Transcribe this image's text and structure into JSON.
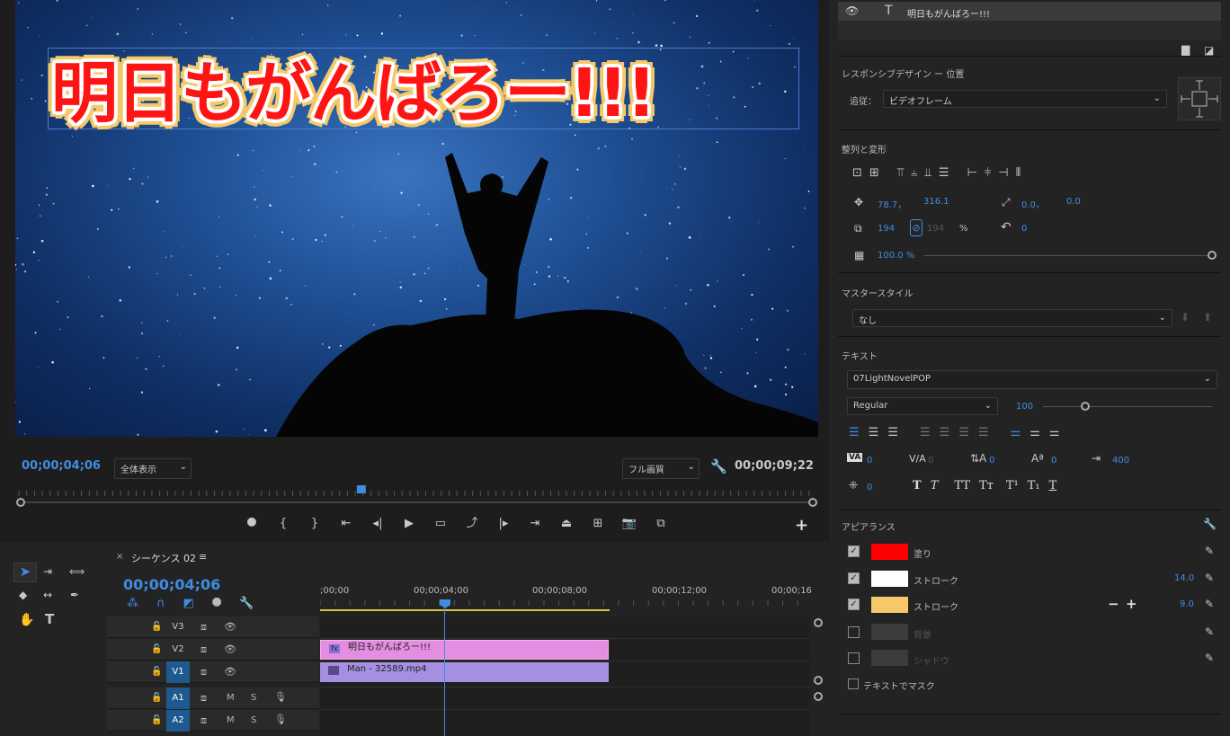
{
  "monitor": {
    "title_text": "明日もがんばろー!!!",
    "current_timecode": "00;00;04;06",
    "zoom_select": "全体表示",
    "quality_select": "フル画質",
    "duration_timecode": "00;00;09;22",
    "playhead_fraction": 0.43
  },
  "timeline": {
    "sequence_tab": "シーケンス 02",
    "timecode": "00;00;04;06",
    "ruler": [
      ";00;00",
      "00;00;04;00",
      "00;00;08;00",
      "00;00;12;00",
      "00;00;16"
    ],
    "tracks": [
      {
        "label": "V3",
        "target": ""
      },
      {
        "label": "V2",
        "target": ""
      },
      {
        "label": "V1",
        "target": "V1"
      },
      {
        "label": "A1",
        "target": "A1"
      },
      {
        "label": "A2",
        "target": "A2"
      }
    ],
    "audio_m": "M",
    "audio_s": "S",
    "clips": {
      "v2": "明日もがんばろー!!!",
      "v1": "Man - 32589.mp4"
    },
    "fx_badge": "fx"
  },
  "panel": {
    "layer_name": "明日もがんばろー!!!",
    "responsive_title": "レスポンシブデザイン ー 位置",
    "follow_label": "追従：",
    "follow_value": "ビデオフレーム",
    "align_title": "整列と変形",
    "position_x": "78.7，",
    "position_y": "316.1",
    "anchor_x": "0.0，",
    "anchor_y": "0.0",
    "scale": "194",
    "scale_locked": "194",
    "percent": "%",
    "rotation": "0",
    "opacity": "100.0 %",
    "master_title": "マスタースタイル",
    "master_value": "なし",
    "text_title": "テキスト",
    "font_name": "07LightNovelPOP",
    "font_style": "Regular",
    "font_size": "100",
    "kerning": "0",
    "tracking": "0",
    "leading": "0",
    "baseline": "0",
    "tab_width": "400",
    "tsume": "0",
    "appearance_title": "アピアランス",
    "fill_label": "塗り",
    "stroke1_label": "ストローク",
    "stroke1_value": "14.0",
    "stroke2_label": "ストローク",
    "stroke2_value": "9.0",
    "bg_label": "背景",
    "shadow_label": "シャドウ",
    "mask_label": "テキストでマスク",
    "colors": {
      "fill": "#ff0000",
      "stroke1": "#ffffff",
      "stroke2": "#f5c96a",
      "accent": "#3f8de2"
    }
  }
}
